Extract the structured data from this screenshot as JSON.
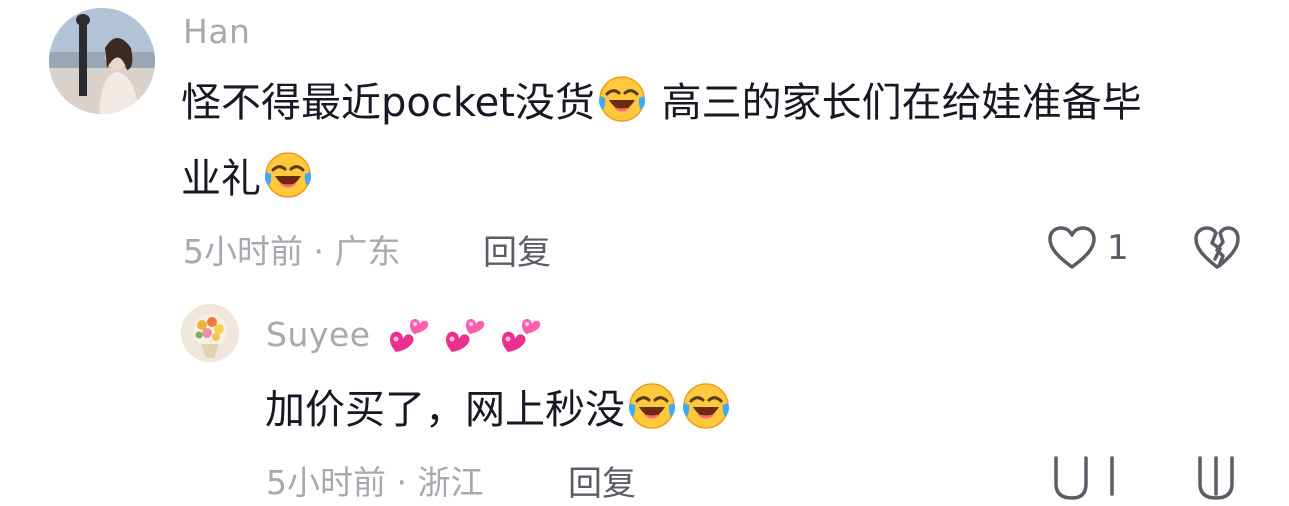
{
  "main_comment": {
    "username": "Han",
    "text_line1_part1": "怪不得最近pocket没货",
    "text_line1_part2": "高三的家长们在给娃准备毕",
    "text_line2": "业礼",
    "emoji": "face-with-tears-of-joy",
    "time": "5小时前",
    "location": "广东",
    "separator": "·",
    "reply_label": "回复",
    "like_count": "1"
  },
  "reply_comment": {
    "username": "Suyee",
    "username_emoji": "two-hearts",
    "text": "加价买了，网上秒没",
    "emoji": "face-with-tears-of-joy",
    "time": "5小时前",
    "location": "浙江",
    "separator": "·",
    "reply_label": "回复"
  },
  "colors": {
    "text_primary": "#161823",
    "text_secondary": "#a7a9b0",
    "action": "#5a5c66"
  }
}
